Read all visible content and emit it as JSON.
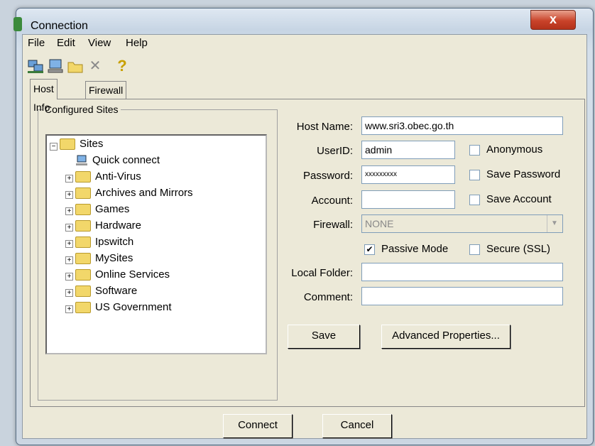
{
  "window": {
    "title": "Connection",
    "close_glyph": "x"
  },
  "menu": {
    "items": [
      "File",
      "Edit",
      "View",
      "Help"
    ]
  },
  "toolbar": {
    "icons": [
      "connect-icon",
      "computer-icon",
      "folder-icon",
      "delete-icon",
      "help-icon"
    ],
    "help_glyph": "?",
    "delete_glyph": "✕"
  },
  "tabs": [
    {
      "label": "Host Info",
      "active": true
    },
    {
      "label": "Firewall",
      "active": false
    }
  ],
  "group": {
    "label": "Configured Sites"
  },
  "tree": {
    "root": "Sites",
    "quick": "Quick connect",
    "items": [
      "Anti-Virus",
      "Archives and Mirrors",
      "Games",
      "Hardware",
      "Ipswitch",
      "MySites",
      "Online Services",
      "Software",
      "US Government"
    ]
  },
  "form": {
    "host_label": "Host Name:",
    "host_value": "www.sri3.obec.go.th",
    "user_label": "UserID:",
    "user_value": "admin",
    "pass_label": "Password:",
    "pass_value": "xxxxxxxxx",
    "account_label": "Account:",
    "account_value": "",
    "firewall_label": "Firewall:",
    "firewall_value": "NONE",
    "anonymous_label": "Anonymous",
    "anonymous_checked": false,
    "savepass_label": "Save Password",
    "savepass_checked": false,
    "saveacct_label": "Save Account",
    "saveacct_checked": false,
    "passive_label": "Passive Mode",
    "passive_checked": true,
    "secure_label": "Secure (SSL)",
    "secure_checked": false,
    "local_label": "Local Folder:",
    "local_value": "",
    "comment_label": "Comment:",
    "comment_value": ""
  },
  "buttons": {
    "save": "Save",
    "advanced": "Advanced Properties...",
    "connect": "Connect",
    "cancel": "Cancel"
  },
  "check_glyph": "✔",
  "tree_expand_glyph": "+",
  "tree_collapse_glyph": "−",
  "dropdown_glyph": "▼"
}
